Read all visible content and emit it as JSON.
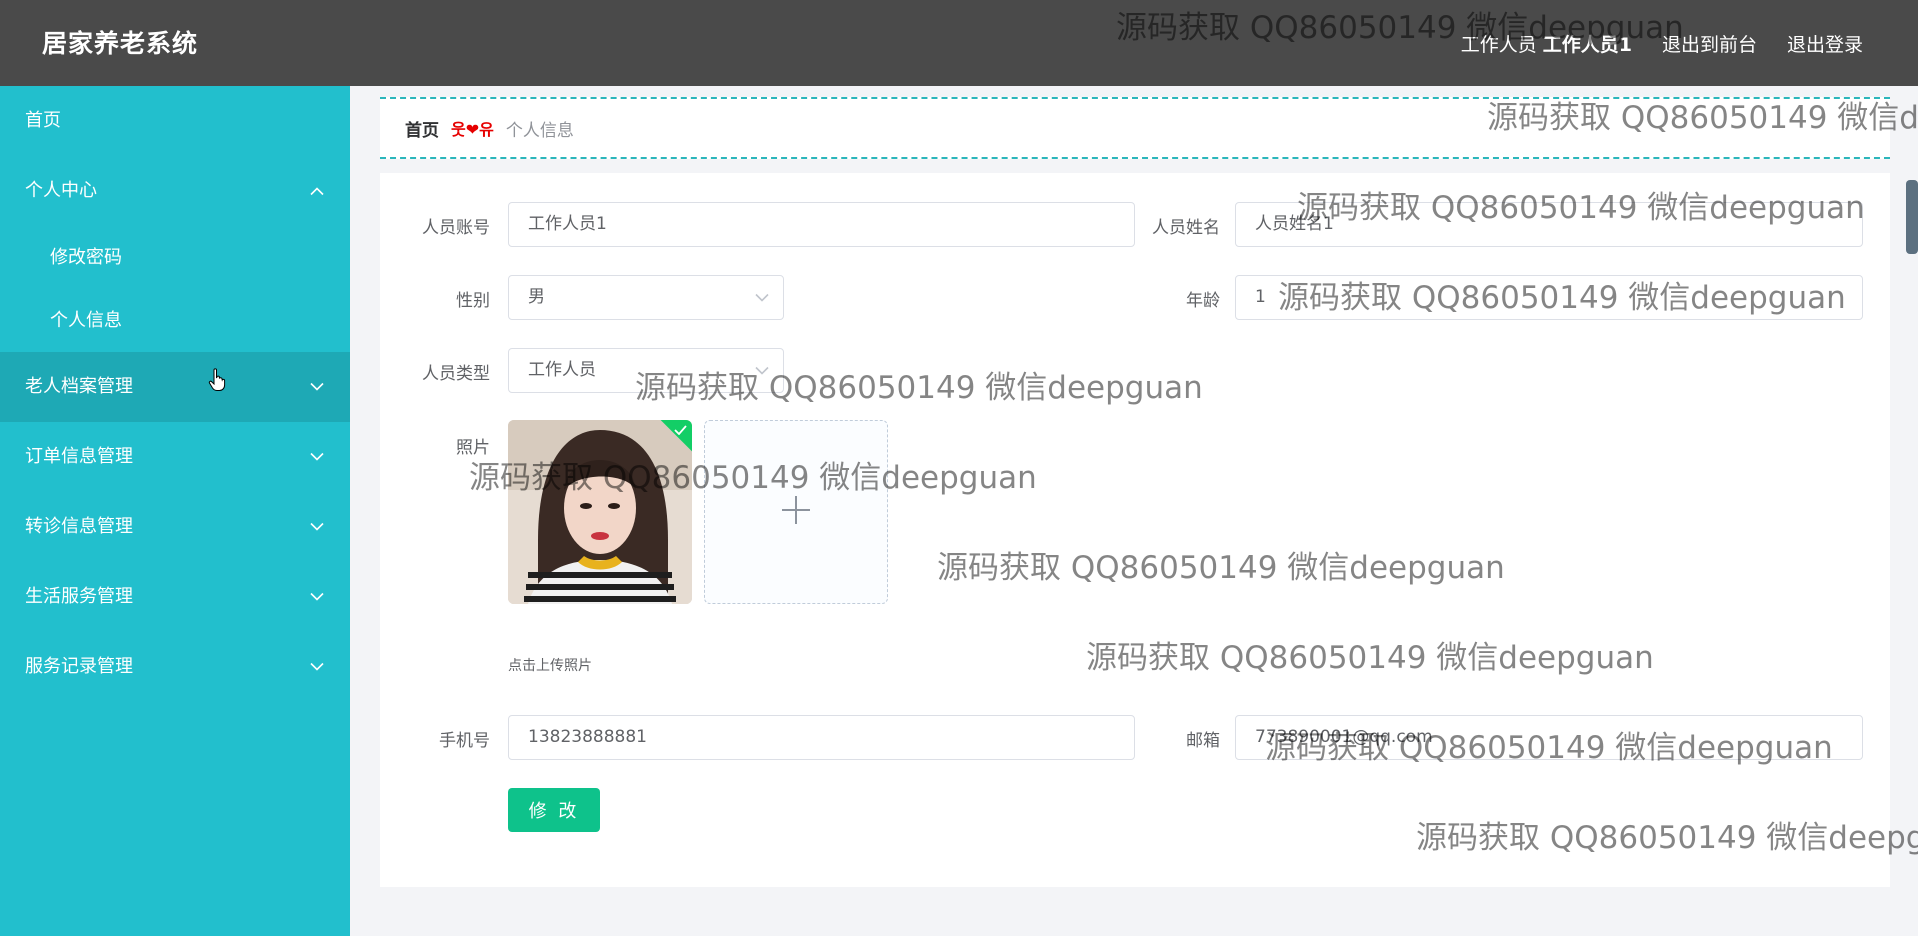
{
  "header": {
    "app_title": "居家养老系统",
    "user_role": "工作人员",
    "user_name": "工作人员1",
    "back_to_front": "退出到前台",
    "logout": "退出登录"
  },
  "sidebar": {
    "items": [
      {
        "label": "首页"
      },
      {
        "label": "个人中心"
      },
      {
        "label": "修改密码"
      },
      {
        "label": "个人信息"
      },
      {
        "label": "老人档案管理"
      },
      {
        "label": "订单信息管理"
      },
      {
        "label": "转诊信息管理"
      },
      {
        "label": "生活服务管理"
      },
      {
        "label": "服务记录管理"
      }
    ]
  },
  "breadcrumb": {
    "home": "首页",
    "separator": "웃❤유",
    "current": "个人信息"
  },
  "form": {
    "account_label": "人员账号",
    "account_value": "工作人员1",
    "name_label": "人员姓名",
    "name_value": "人员姓名1",
    "gender_label": "性别",
    "gender_value": "男",
    "age_label": "年龄",
    "age_value": "1",
    "type_label": "人员类型",
    "type_value": "工作人员",
    "photo_label": "照片",
    "upload_tip": "点击上传照片",
    "phone_label": "手机号",
    "phone_value": "13823888881",
    "email_label": "邮箱",
    "email_value": "773890001@qq.com",
    "save_label": "修 改"
  },
  "watermark": {
    "text": "源码获取 QQ86050149 微信deepguan"
  },
  "colors": {
    "header_bg": "#4a4a4a",
    "sidebar_bg": "#22bfcd",
    "sidebar_active_bg": "#1ea9b5",
    "save_button": "#0ec28b",
    "breadcrumb_border": "#2bb6bb"
  }
}
